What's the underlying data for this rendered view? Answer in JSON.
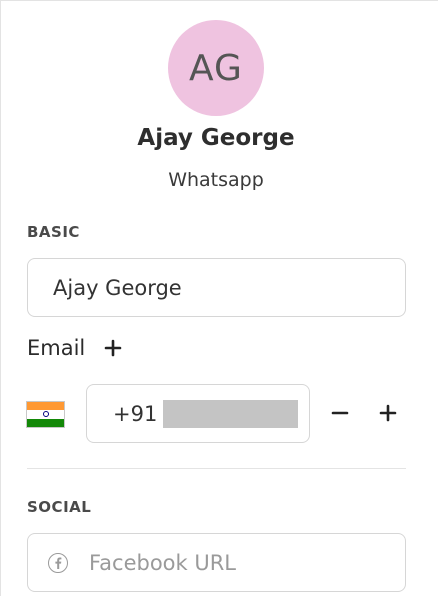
{
  "contact": {
    "initials": "AG",
    "name": "Ajay George",
    "source": "Whatsapp",
    "avatar_color": "#efc3e0"
  },
  "basic": {
    "section_label": "BASIC",
    "name_value": "Ajay George"
  },
  "email": {
    "label": "Email",
    "add_icon": "plus-icon"
  },
  "phone": {
    "country_flag": "india-flag-icon",
    "dial_code": "+91",
    "remove_icon": "minus-icon",
    "add_icon": "plus-icon"
  },
  "social": {
    "section_label": "SOCIAL",
    "facebook_icon": "facebook-icon",
    "facebook_placeholder": "Facebook URL",
    "facebook_value": ""
  }
}
